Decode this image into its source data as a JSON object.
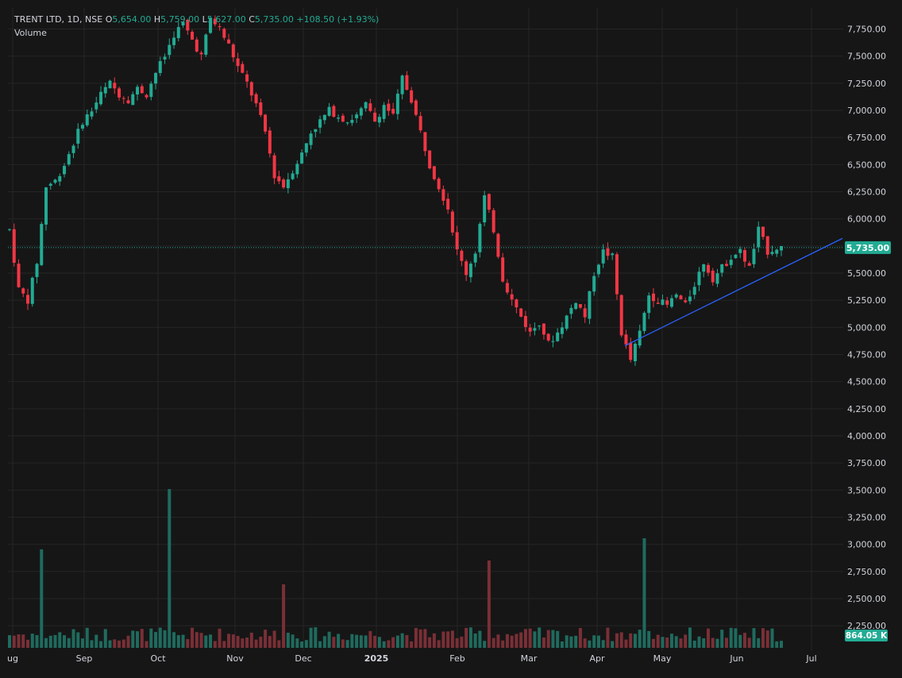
{
  "header": {
    "symbol": "TRENT LTD, 1D, NSE",
    "o_label": "O",
    "o_value": "5,654.00",
    "h_label": "H",
    "h_value": "5,759.00",
    "l_label": "L",
    "l_value": "5,627.00",
    "c_label": "C",
    "c_value": "5,735.00",
    "change": "+108.50 (+1.93%)",
    "volume_label": "Volume"
  },
  "colors": {
    "background": "#161616",
    "grid": "#252525",
    "axis_text": "#d1d4dc",
    "up": "#22ab94",
    "down": "#f23645",
    "up_volume": "#1f6b5e",
    "down_volume": "#7a2f36",
    "trendline": "#2962ff",
    "last_price_badge": "#22ab94"
  },
  "chart_data": {
    "type": "candlestick",
    "instrument": "TRENT LTD",
    "interval": "1D",
    "exchange": "NSE",
    "price_axis": {
      "ylim": [
        3900,
        7900
      ],
      "ticks": [
        7750,
        7500,
        7250,
        7000,
        6750,
        6500,
        6250,
        6000,
        5750,
        5500,
        5250,
        5000,
        4750,
        4500,
        4250,
        4000,
        3750,
        3500,
        3250,
        3000,
        2750,
        2500,
        2250
      ],
      "tick_labels": [
        "7,750.00",
        "7,500.00",
        "7,250.00",
        "7,000.00",
        "6,750.00",
        "6,500.00",
        "6,250.00",
        "6,000.00",
        "5,750.00",
        "5,500.00",
        "5,250.00",
        "5,000.00",
        "4,750.00",
        "4,500.00",
        "4,250.00",
        "4,000.00",
        "3,750.00",
        "3,500.00",
        "3,250.00",
        "3,000.00",
        "2,750.00",
        "2,500.00",
        "2,250.00"
      ],
      "last_price": 5735,
      "last_price_label": "5,735.00"
    },
    "time_axis": {
      "labels": [
        "ug",
        "Sep",
        "Oct",
        "Nov",
        "Dec",
        "2025",
        "Feb",
        "Mar",
        "Apr",
        "May",
        "Jun",
        "Jul"
      ]
    },
    "volume": {
      "last_label": "864.05 K"
    },
    "trendline": {
      "start": {
        "date": "2025-04-09",
        "price": 4830
      },
      "end": {
        "date": "2025-07-07",
        "price": 5820
      }
    },
    "segments": [
      [
        0,
        5900
      ],
      [
        2,
        5350
      ],
      [
        4,
        5250
      ],
      [
        6,
        5600
      ],
      [
        8,
        6300
      ],
      [
        10,
        6350
      ],
      [
        12,
        6500
      ],
      [
        14,
        6700
      ],
      [
        16,
        6900
      ],
      [
        18,
        7000
      ],
      [
        20,
        7150
      ],
      [
        22,
        7250
      ],
      [
        24,
        7150
      ],
      [
        26,
        7100
      ],
      [
        28,
        7200
      ],
      [
        30,
        7150
      ],
      [
        32,
        7350
      ],
      [
        34,
        7500
      ],
      [
        36,
        7700
      ],
      [
        38,
        7800
      ],
      [
        40,
        7650
      ],
      [
        42,
        7500
      ],
      [
        44,
        7850
      ],
      [
        46,
        7750
      ],
      [
        48,
        7600
      ],
      [
        50,
        7400
      ],
      [
        52,
        7250
      ],
      [
        54,
        7050
      ],
      [
        56,
        6800
      ],
      [
        58,
        6400
      ],
      [
        60,
        6300
      ],
      [
        62,
        6450
      ],
      [
        64,
        6600
      ],
      [
        66,
        6800
      ],
      [
        68,
        6900
      ],
      [
        70,
        7000
      ],
      [
        72,
        6950
      ],
      [
        74,
        6900
      ],
      [
        76,
        6950
      ],
      [
        78,
        7050
      ],
      [
        80,
        6900
      ],
      [
        82,
        7050
      ],
      [
        84,
        6950
      ],
      [
        86,
        7300
      ],
      [
        88,
        7100
      ],
      [
        90,
        6800
      ],
      [
        92,
        6500
      ],
      [
        94,
        6300
      ],
      [
        96,
        6100
      ],
      [
        98,
        5700
      ],
      [
        100,
        5500
      ],
      [
        102,
        5700
      ],
      [
        104,
        6200
      ],
      [
        106,
        5900
      ],
      [
        108,
        5450
      ],
      [
        110,
        5250
      ],
      [
        112,
        5100
      ],
      [
        114,
        4950
      ],
      [
        116,
        5050
      ],
      [
        118,
        4850
      ],
      [
        120,
        4950
      ],
      [
        122,
        5100
      ],
      [
        124,
        5250
      ],
      [
        126,
        5100
      ],
      [
        128,
        5500
      ],
      [
        130,
        5700
      ],
      [
        132,
        5650
      ],
      [
        134,
        4950
      ],
      [
        136,
        4700
      ],
      [
        138,
        4950
      ],
      [
        140,
        5300
      ],
      [
        142,
        5250
      ],
      [
        144,
        5200
      ],
      [
        146,
        5300
      ],
      [
        148,
        5200
      ],
      [
        150,
        5400
      ],
      [
        152,
        5600
      ],
      [
        154,
        5450
      ],
      [
        156,
        5550
      ],
      [
        158,
        5650
      ],
      [
        160,
        5700
      ],
      [
        162,
        5550
      ],
      [
        164,
        5900
      ],
      [
        166,
        5700
      ],
      [
        168,
        5735
      ]
    ]
  }
}
